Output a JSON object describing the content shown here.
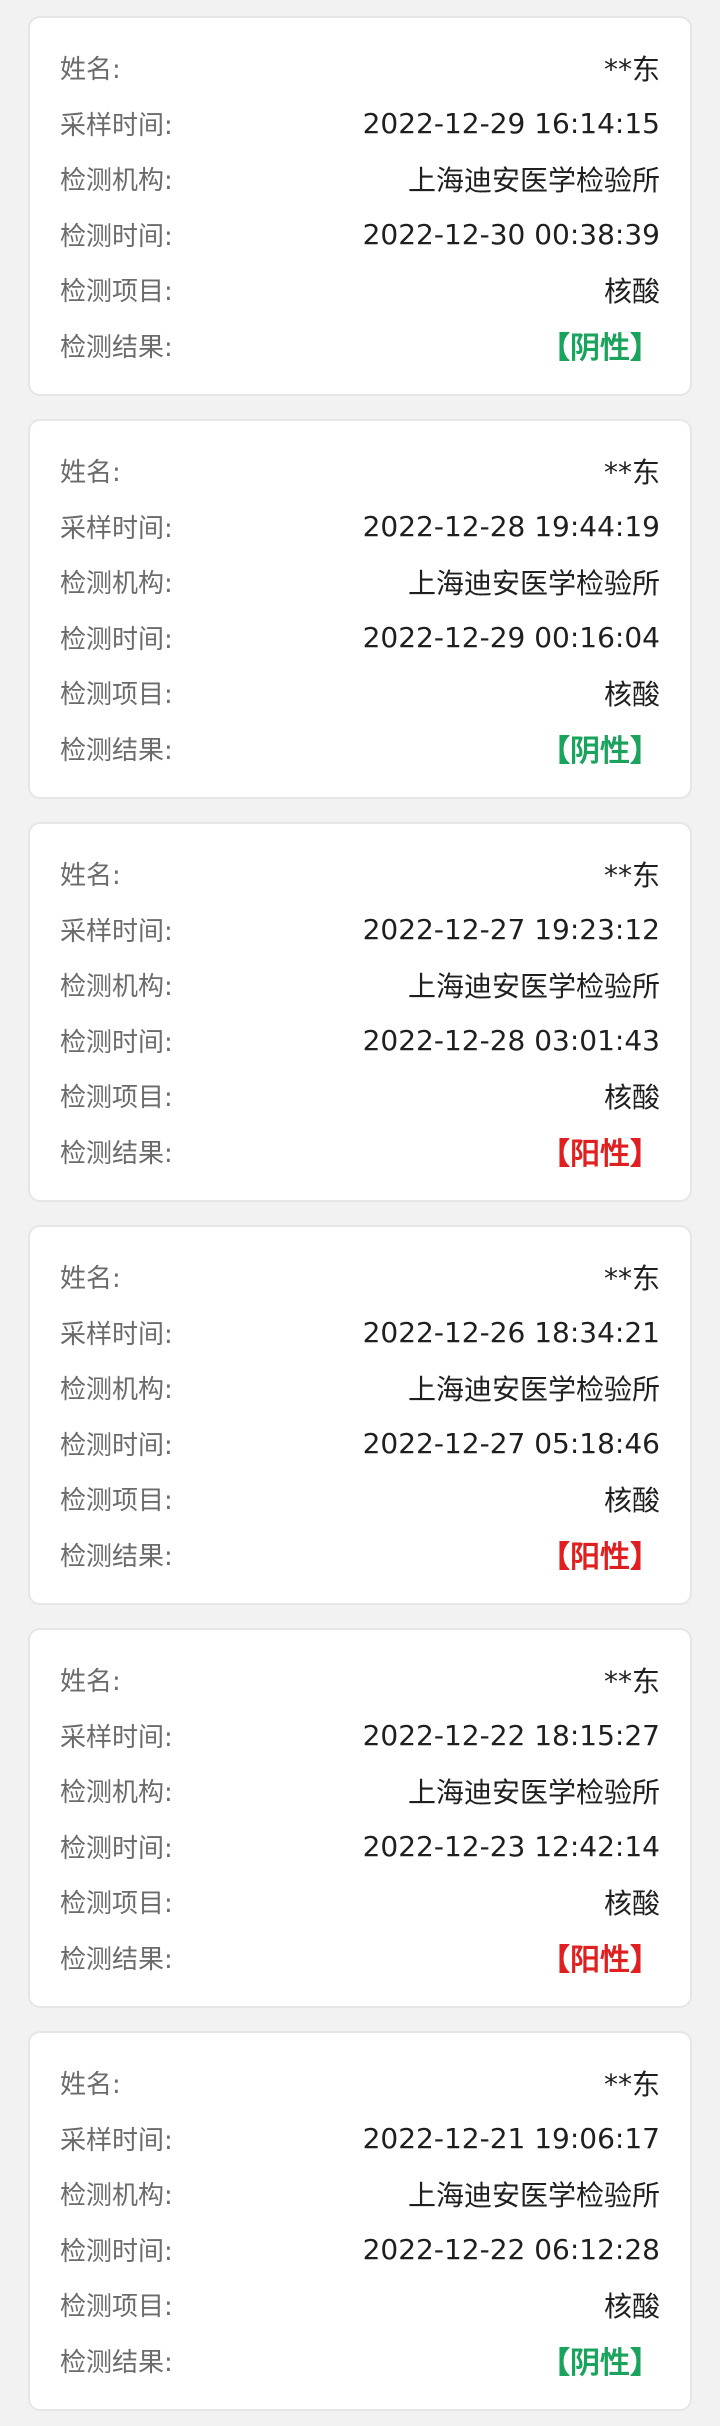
{
  "labels": {
    "name": "姓名:",
    "sample_time": "采样时间:",
    "institution": "检测机构:",
    "test_time": "检测时间:",
    "test_item": "检测项目:",
    "result": "检测结果:"
  },
  "colors": {
    "negative": "#1aa35c",
    "positive": "#e02020"
  },
  "records": [
    {
      "name": "**东",
      "sample_time": "2022-12-29 16:14:15",
      "institution": "上海迪安医学检验所",
      "test_time": "2022-12-30 00:38:39",
      "test_item": "核酸",
      "result": "【阴性】",
      "result_type": "negative"
    },
    {
      "name": "**东",
      "sample_time": "2022-12-28 19:44:19",
      "institution": "上海迪安医学检验所",
      "test_time": "2022-12-29 00:16:04",
      "test_item": "核酸",
      "result": "【阴性】",
      "result_type": "negative"
    },
    {
      "name": "**东",
      "sample_time": "2022-12-27 19:23:12",
      "institution": "上海迪安医学检验所",
      "test_time": "2022-12-28 03:01:43",
      "test_item": "核酸",
      "result": "【阳性】",
      "result_type": "positive"
    },
    {
      "name": "**东",
      "sample_time": "2022-12-26 18:34:21",
      "institution": "上海迪安医学检验所",
      "test_time": "2022-12-27 05:18:46",
      "test_item": "核酸",
      "result": "【阳性】",
      "result_type": "positive"
    },
    {
      "name": "**东",
      "sample_time": "2022-12-22 18:15:27",
      "institution": "上海迪安医学检验所",
      "test_time": "2022-12-23 12:42:14",
      "test_item": "核酸",
      "result": "【阳性】",
      "result_type": "positive"
    },
    {
      "name": "**东",
      "sample_time": "2022-12-21 19:06:17",
      "institution": "上海迪安医学检验所",
      "test_time": "2022-12-22 06:12:28",
      "test_item": "核酸",
      "result": "【阴性】",
      "result_type": "negative"
    }
  ]
}
